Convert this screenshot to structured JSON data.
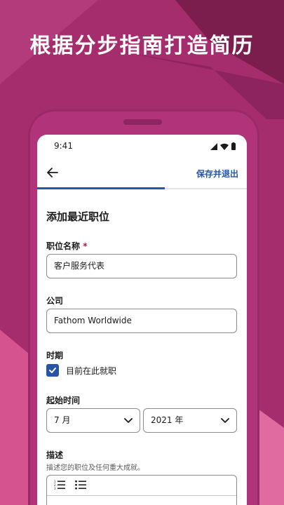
{
  "headline": "根据分步指南打造简历",
  "status": {
    "time": "9:41"
  },
  "app_bar": {
    "save_exit_label": "保存并退出",
    "progress_fraction": 0.61
  },
  "form": {
    "section_title": "添加最近职位",
    "job_title": {
      "label": "职位名称",
      "required_mark": "*",
      "value": "客户服务代表"
    },
    "company": {
      "label": "公司",
      "value": "Fathom Worldwide"
    },
    "period": {
      "label": "时期",
      "current_job_label": "目前在此就职",
      "current_job_checked": true
    },
    "start_time": {
      "label": "起始时间",
      "month_value": "7 月",
      "year_value": "2021 年"
    },
    "description": {
      "label": "描述",
      "hint": "描述您的职位及任何重大成就。"
    }
  },
  "colors": {
    "accent": "#2654a6",
    "background": "#a52c6d",
    "required": "#c8102e"
  },
  "icons": [
    "back-arrow-icon",
    "signal-icon",
    "wifi-icon",
    "battery-icon",
    "check-icon",
    "chevron-down-icon",
    "numbered-list-icon",
    "bulleted-list-icon"
  ]
}
